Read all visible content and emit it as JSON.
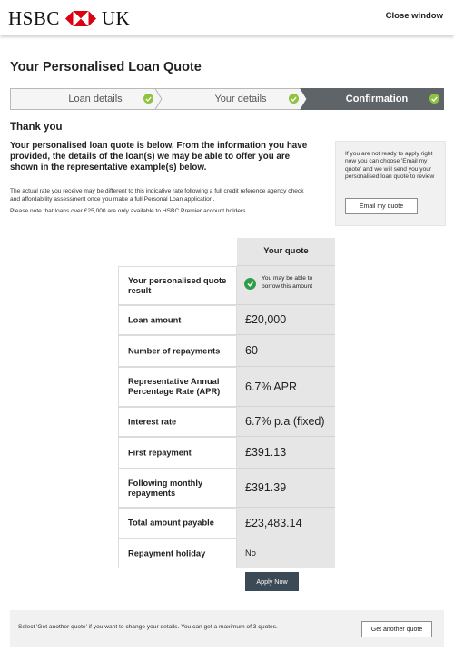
{
  "header": {
    "logo_left": "HSBC",
    "logo_right": "UK",
    "close_label": "Close window"
  },
  "page_title": "Your Personalised Loan Quote",
  "steps": [
    {
      "label": "Loan details",
      "complete": true
    },
    {
      "label": "Your details",
      "complete": true
    },
    {
      "label": "Confirmation",
      "complete": true,
      "active": true
    }
  ],
  "intro": {
    "thank_you": "Thank you",
    "headline": "Your personalised loan quote is below. From the information you have provided, the details of the loan(s) we may be able to offer you are shown in the representative example(s) below.",
    "rate_note": "The actual rate you receive may be different to this indicative rate following a full credit reference agency check and affordability assessment once you make a full Personal Loan application.",
    "premier_note": "Please note that loans over £25,000 are only available to HSBC Premier account holders."
  },
  "email_box": {
    "text": "If you are not ready to apply right now you can choose 'Email my quote' and we will send you your personalised loan quote to review",
    "button": "Email my quote"
  },
  "quote_table": {
    "header": "Your quote",
    "result_label": "Your personalised quote result",
    "result_value": "You may be able to borrow this amount",
    "rows": [
      {
        "label": "Loan amount",
        "value": "£20,000"
      },
      {
        "label": "Number of repayments",
        "value": "60"
      },
      {
        "label": "Representative Annual Percentage Rate (APR)",
        "value": "6.7% APR"
      },
      {
        "label": "Interest rate",
        "value": "6.7% p.a (fixed)"
      },
      {
        "label": "First repayment",
        "value": "£391.13"
      },
      {
        "label": "Following monthly repayments",
        "value": "£391.39"
      },
      {
        "label": "Total amount payable",
        "value": "£23,483.14"
      },
      {
        "label": "Repayment holiday",
        "value": "No"
      }
    ]
  },
  "apply_button": "Apply Now",
  "footer": {
    "text": "Select 'Get another quote' if you want to change your details. You can get a maximum of 3 quotes.",
    "button": "Get another quote"
  },
  "colors": {
    "brand_red": "#db0011",
    "step_complete_bg": "#f5f5f5",
    "step_active_bg": "#5f6468",
    "check_green": "#8cc43f",
    "result_green": "#2f9e4b",
    "apply_button_bg": "#3c4a56"
  }
}
